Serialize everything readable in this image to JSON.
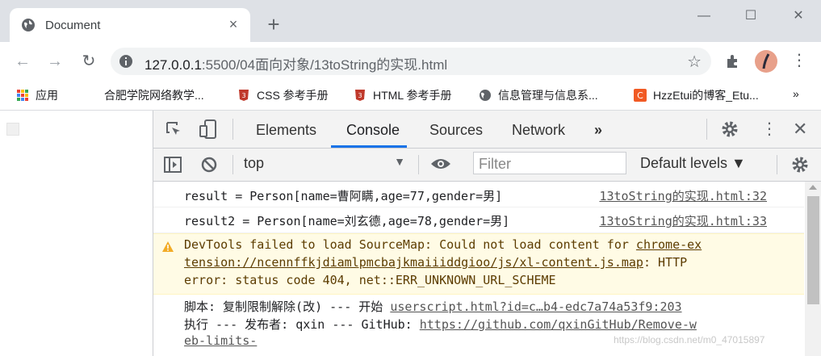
{
  "tab": {
    "title": "Document",
    "close": "×"
  },
  "new_tab": "+",
  "window_controls": {
    "minimize": "—",
    "maximize": "☐",
    "close": "✕"
  },
  "nav": {
    "back": "←",
    "forward": "→",
    "reload": "↻"
  },
  "omnibox": {
    "host": "127.0.0.1",
    "path": ":5500/04面向对象/13toString的实现.html",
    "star": "☆"
  },
  "more_menu": "⋮",
  "bookmarks": [
    {
      "label": "应用",
      "icon": "apps-grid-icon"
    },
    {
      "label": "合肥学院网络教学...",
      "icon": "none"
    },
    {
      "label": "CSS 参考手册",
      "icon": "w3-logo-icon"
    },
    {
      "label": "HTML 参考手册",
      "icon": "w3-logo-icon"
    },
    {
      "label": "信息管理与信息系...",
      "icon": "globe-icon"
    },
    {
      "label": "HzzEtui的博客_Etu...",
      "icon": "csdn-logo-icon"
    }
  ],
  "bookmarks_overflow": "»",
  "devtools": {
    "tabs": [
      "Elements",
      "Console",
      "Sources",
      "Network"
    ],
    "active_tab": "Console",
    "more_tabs": "»",
    "context": "top",
    "filter_placeholder": "Filter",
    "levels": "Default levels ▼",
    "accent_color": "#1a73e8"
  },
  "console": {
    "logs": [
      {
        "message": "result = Person[name=曹阿瞒,age=77,gender=男]",
        "source": "13toString的实现.html:32"
      },
      {
        "message": "result2 = Person[name=刘玄德,age=78,gender=男]",
        "source": "13toString的实现.html:33"
      }
    ],
    "warning": {
      "line1_text": "DevTools failed to load SourceMap: Could not load content for ",
      "line1_link": "chrome-ex",
      "line2_link": "tension://ncennffkjdiamlpmcbajkmaiiiddgioo/js/xl-content.js.map",
      "line2_text": ": HTTP",
      "line3_text": "error: status code 404, net::ERR_UNKNOWN_URL_SCHEME",
      "color": "#5c3c00",
      "background": "#fffbe5"
    },
    "script_log": {
      "line1_text": "脚本: 复制限制解除(改) --- 开始 ",
      "line1_link": "userscript.html?id=c…b4-edc7a74a53f9:203",
      "line2_text": "执行 --- 发布者: qxin --- GitHub: ",
      "line2_link": "https://github.com/qxinGitHub/Remove-w",
      "line3_link": "eb-limits-"
    }
  },
  "watermark": "https://blog.csdn.net/m0_47015897"
}
